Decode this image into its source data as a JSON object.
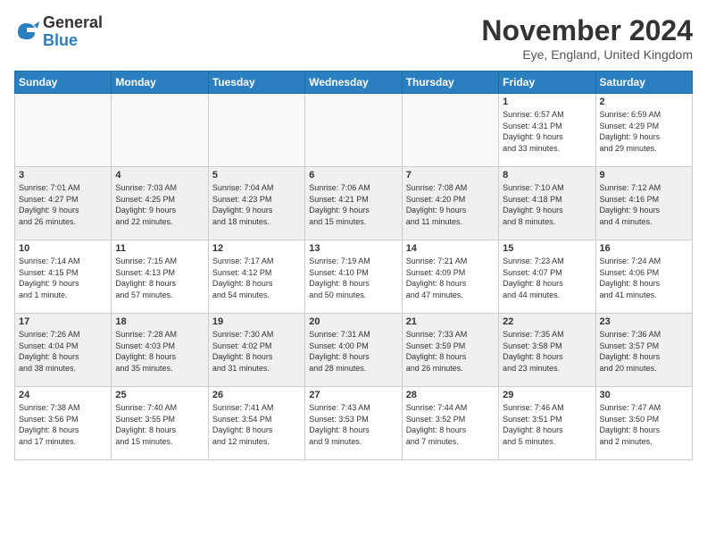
{
  "logo": {
    "general": "General",
    "blue": "Blue"
  },
  "header": {
    "month": "November 2024",
    "location": "Eye, England, United Kingdom"
  },
  "weekdays": [
    "Sunday",
    "Monday",
    "Tuesday",
    "Wednesday",
    "Thursday",
    "Friday",
    "Saturday"
  ],
  "weeks": [
    [
      {
        "day": "",
        "info": ""
      },
      {
        "day": "",
        "info": ""
      },
      {
        "day": "",
        "info": ""
      },
      {
        "day": "",
        "info": ""
      },
      {
        "day": "",
        "info": ""
      },
      {
        "day": "1",
        "info": "Sunrise: 6:57 AM\nSunset: 4:31 PM\nDaylight: 9 hours\nand 33 minutes."
      },
      {
        "day": "2",
        "info": "Sunrise: 6:59 AM\nSunset: 4:29 PM\nDaylight: 9 hours\nand 29 minutes."
      }
    ],
    [
      {
        "day": "3",
        "info": "Sunrise: 7:01 AM\nSunset: 4:27 PM\nDaylight: 9 hours\nand 26 minutes."
      },
      {
        "day": "4",
        "info": "Sunrise: 7:03 AM\nSunset: 4:25 PM\nDaylight: 9 hours\nand 22 minutes."
      },
      {
        "day": "5",
        "info": "Sunrise: 7:04 AM\nSunset: 4:23 PM\nDaylight: 9 hours\nand 18 minutes."
      },
      {
        "day": "6",
        "info": "Sunrise: 7:06 AM\nSunset: 4:21 PM\nDaylight: 9 hours\nand 15 minutes."
      },
      {
        "day": "7",
        "info": "Sunrise: 7:08 AM\nSunset: 4:20 PM\nDaylight: 9 hours\nand 11 minutes."
      },
      {
        "day": "8",
        "info": "Sunrise: 7:10 AM\nSunset: 4:18 PM\nDaylight: 9 hours\nand 8 minutes."
      },
      {
        "day": "9",
        "info": "Sunrise: 7:12 AM\nSunset: 4:16 PM\nDaylight: 9 hours\nand 4 minutes."
      }
    ],
    [
      {
        "day": "10",
        "info": "Sunrise: 7:14 AM\nSunset: 4:15 PM\nDaylight: 9 hours\nand 1 minute."
      },
      {
        "day": "11",
        "info": "Sunrise: 7:15 AM\nSunset: 4:13 PM\nDaylight: 8 hours\nand 57 minutes."
      },
      {
        "day": "12",
        "info": "Sunrise: 7:17 AM\nSunset: 4:12 PM\nDaylight: 8 hours\nand 54 minutes."
      },
      {
        "day": "13",
        "info": "Sunrise: 7:19 AM\nSunset: 4:10 PM\nDaylight: 8 hours\nand 50 minutes."
      },
      {
        "day": "14",
        "info": "Sunrise: 7:21 AM\nSunset: 4:09 PM\nDaylight: 8 hours\nand 47 minutes."
      },
      {
        "day": "15",
        "info": "Sunrise: 7:23 AM\nSunset: 4:07 PM\nDaylight: 8 hours\nand 44 minutes."
      },
      {
        "day": "16",
        "info": "Sunrise: 7:24 AM\nSunset: 4:06 PM\nDaylight: 8 hours\nand 41 minutes."
      }
    ],
    [
      {
        "day": "17",
        "info": "Sunrise: 7:26 AM\nSunset: 4:04 PM\nDaylight: 8 hours\nand 38 minutes."
      },
      {
        "day": "18",
        "info": "Sunrise: 7:28 AM\nSunset: 4:03 PM\nDaylight: 8 hours\nand 35 minutes."
      },
      {
        "day": "19",
        "info": "Sunrise: 7:30 AM\nSunset: 4:02 PM\nDaylight: 8 hours\nand 31 minutes."
      },
      {
        "day": "20",
        "info": "Sunrise: 7:31 AM\nSunset: 4:00 PM\nDaylight: 8 hours\nand 28 minutes."
      },
      {
        "day": "21",
        "info": "Sunrise: 7:33 AM\nSunset: 3:59 PM\nDaylight: 8 hours\nand 26 minutes."
      },
      {
        "day": "22",
        "info": "Sunrise: 7:35 AM\nSunset: 3:58 PM\nDaylight: 8 hours\nand 23 minutes."
      },
      {
        "day": "23",
        "info": "Sunrise: 7:36 AM\nSunset: 3:57 PM\nDaylight: 8 hours\nand 20 minutes."
      }
    ],
    [
      {
        "day": "24",
        "info": "Sunrise: 7:38 AM\nSunset: 3:56 PM\nDaylight: 8 hours\nand 17 minutes."
      },
      {
        "day": "25",
        "info": "Sunrise: 7:40 AM\nSunset: 3:55 PM\nDaylight: 8 hours\nand 15 minutes."
      },
      {
        "day": "26",
        "info": "Sunrise: 7:41 AM\nSunset: 3:54 PM\nDaylight: 8 hours\nand 12 minutes."
      },
      {
        "day": "27",
        "info": "Sunrise: 7:43 AM\nSunset: 3:53 PM\nDaylight: 8 hours\nand 9 minutes."
      },
      {
        "day": "28",
        "info": "Sunrise: 7:44 AM\nSunset: 3:52 PM\nDaylight: 8 hours\nand 7 minutes."
      },
      {
        "day": "29",
        "info": "Sunrise: 7:46 AM\nSunset: 3:51 PM\nDaylight: 8 hours\nand 5 minutes."
      },
      {
        "day": "30",
        "info": "Sunrise: 7:47 AM\nSunset: 3:50 PM\nDaylight: 8 hours\nand 2 minutes."
      }
    ]
  ]
}
